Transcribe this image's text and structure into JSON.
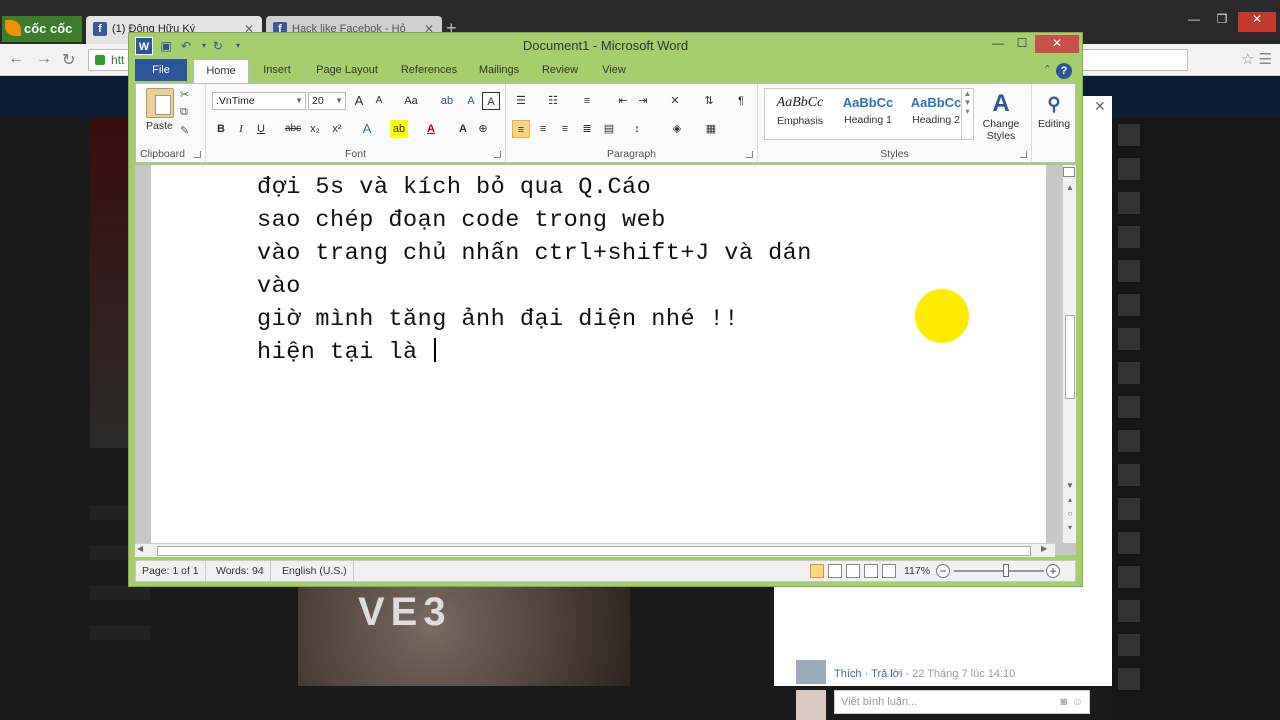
{
  "browser": {
    "logo": "cốc cốc",
    "tabs": [
      {
        "title": "(1) Đông Hữu Ký",
        "active": true
      },
      {
        "title": "Hack like Facebok - Hỏ",
        "active": false
      }
    ],
    "url": "htt"
  },
  "word": {
    "title": "Document1 - Microsoft Word",
    "tabs": [
      "File",
      "Home",
      "Insert",
      "Page Layout",
      "References",
      "Mailings",
      "Review",
      "View"
    ],
    "active_tab": "Home",
    "ribbon": {
      "clipboard": {
        "label": "Clipboard",
        "paste": "Paste"
      },
      "font": {
        "label": "Font",
        "name": ".VnTime",
        "size": "20",
        "bold": "B",
        "italic": "I",
        "underline": "U",
        "strike": "abc",
        "sub": "x₂",
        "sup": "x²",
        "grow": "A",
        "shrink": "A",
        "case": "Aa",
        "clear": "A",
        "highlight": "ab",
        "color": "A"
      },
      "paragraph": {
        "label": "Paragraph",
        "pilcrow": "¶"
      },
      "styles": {
        "label": "Styles",
        "items": [
          {
            "sample": "AaBbCc",
            "name": "Emphasis"
          },
          {
            "sample": "AaBbCc",
            "name": "Heading 1"
          },
          {
            "sample": "AaBbCc",
            "name": "Heading 2"
          }
        ],
        "change_styles": "Change Styles"
      },
      "editing": {
        "label": "Editing"
      }
    },
    "document_lines": [
      "đợi 5s và kích bỏ qua Q.Cáo",
      "sao chép đoạn code trong web",
      "vào trang chủ nhấn ctrl+shift+J và dán",
      "vào",
      "giờ mình tăng ảnh đại diện nhé !!",
      "hiện tại là "
    ],
    "status": {
      "page": "Page: 1 of 1",
      "words": "Words: 94",
      "language": "English (U.S.)",
      "zoom": "117%",
      "zoom_fraction": 0.58
    }
  },
  "facebook": {
    "comment_actions": {
      "like": "Thích",
      "reply": "Trả lời",
      "time": "22 Tháng 7 lúc 14:10"
    },
    "comment_placeholder": "Viết bình luận...",
    "photo_text": "VE3"
  },
  "colors": {
    "word_frame": "#a4cf6c",
    "word_blue": "#2b579a",
    "cursor_highlight": "#ffeb00"
  }
}
